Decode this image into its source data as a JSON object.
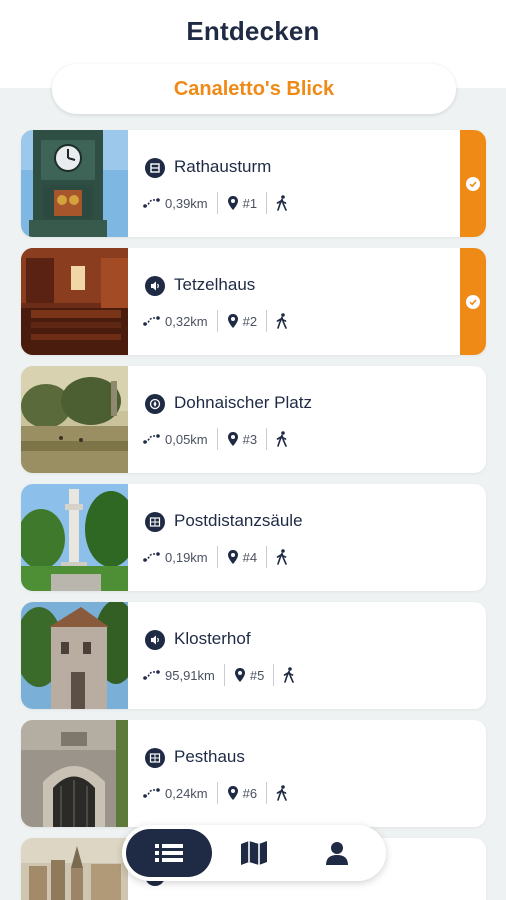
{
  "header": {
    "title": "Entdecken"
  },
  "tour": {
    "name": "Canaletto's Blick"
  },
  "colors": {
    "accent": "#ef8a17",
    "navy": "#1f2a44",
    "background": "#eef2f2"
  },
  "stations": [
    {
      "name": "Rathausturm",
      "distance": "0,39km",
      "number": "#1",
      "category_icon": "building-icon",
      "visited": true
    },
    {
      "name": "Tetzelhaus",
      "distance": "0,32km",
      "number": "#2",
      "category_icon": "audio-icon",
      "visited": true
    },
    {
      "name": "Dohnaischer Platz",
      "distance": "0,05km",
      "number": "#3",
      "category_icon": "compass-icon",
      "visited": false
    },
    {
      "name": "Postdistanzsäule",
      "distance": "0,19km",
      "number": "#4",
      "category_icon": "gallery-icon",
      "visited": false
    },
    {
      "name": "Klosterhof",
      "distance": "95,91km",
      "number": "#5",
      "category_icon": "audio-icon",
      "visited": false
    },
    {
      "name": "Pesthaus",
      "distance": "0,24km",
      "number": "#6",
      "category_icon": "gallery-icon",
      "visited": false
    },
    {
      "name": "",
      "distance": "",
      "number": "",
      "category_icon": "building-icon",
      "visited": false
    }
  ],
  "nav": {
    "items": [
      "list-icon",
      "map-icon",
      "profile-icon"
    ],
    "active": "list-icon"
  }
}
